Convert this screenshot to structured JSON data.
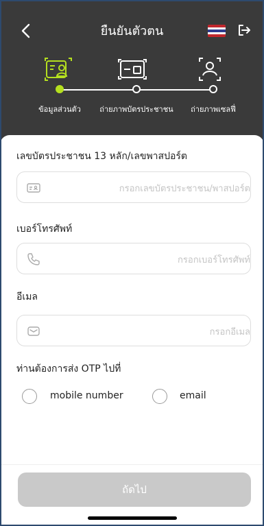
{
  "header": {
    "title": "ยืนยันตัวตน",
    "flag_colors": [
      "#c1272d",
      "#ffffff",
      "#2e3b8f",
      "#ffffff",
      "#c1272d"
    ],
    "back_icon": "chevron-left-icon",
    "logout_icon": "logout-icon"
  },
  "steps": [
    {
      "label": "ข้อมูลส่วนตัว",
      "icon": "personal-info-icon",
      "active": true
    },
    {
      "label": "ถ่ายภาพบัตรประชาชน",
      "icon": "id-card-icon",
      "active": false
    },
    {
      "label": "ถ่ายภาพเซลฟี่",
      "icon": "selfie-icon",
      "active": false
    }
  ],
  "colors": {
    "accent": "#b5e01f",
    "header_bg": "#3a3a3a",
    "button_disabled": "#c9c9c9"
  },
  "form": {
    "id_label": "เลขบัตรประชาชน 13 หลัก/เลขพาสปอร์ต",
    "id_placeholder": "กรอกเลขบัตรประชาชน/พาสปอร์ต",
    "phone_label": "เบอร์โทรศัพท์",
    "phone_placeholder": "กรอกเบอร์โทรศัพท์",
    "email_label": "อีเมล",
    "email_placeholder": "กรอกอีเมล",
    "otp_label": "ท่านต้องการส่ง OTP ไปที่",
    "otp_options": [
      "mobile number",
      "email"
    ]
  },
  "footer": {
    "next_label": "ถัดไป"
  }
}
